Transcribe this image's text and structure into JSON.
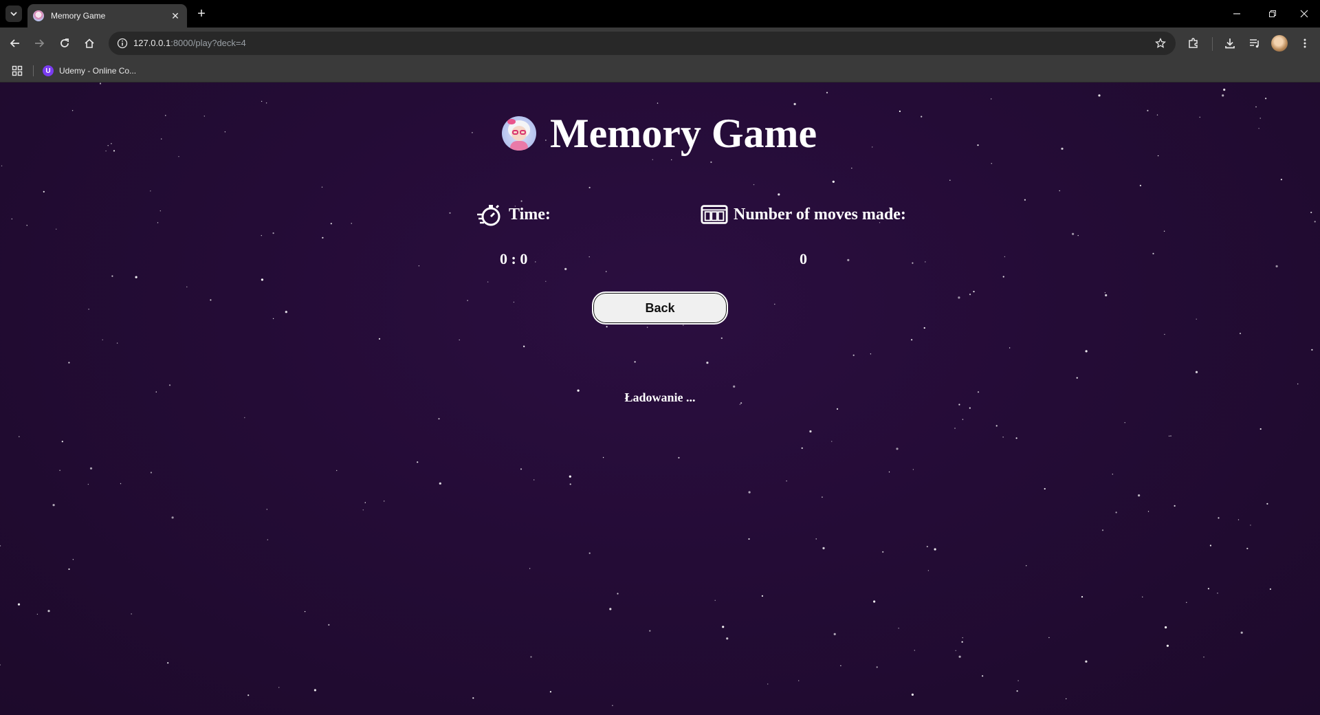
{
  "browser": {
    "tab_title": "Memory Game",
    "url_host": "127.0.0.1",
    "url_rest": ":8000/play?deck=4",
    "bookmark_label": "Udemy - Online Co...",
    "bookmark_favicon_letter": "U"
  },
  "page": {
    "title": "Memory Game",
    "time_label": "Time:",
    "time_value": "0 : 0",
    "moves_label": "Number of moves made:",
    "moves_value": "0",
    "back_label": "Back",
    "loading_text": "Ładowanie ..."
  },
  "colors": {
    "background": "#240c36",
    "text": "#ffffff",
    "button_bg": "#f0f0f0"
  }
}
